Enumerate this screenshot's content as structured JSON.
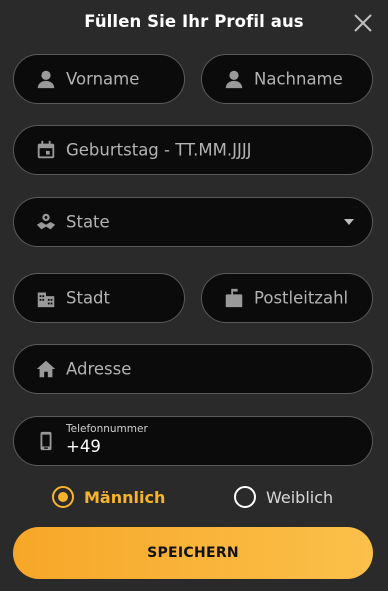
{
  "header": {
    "title": "Füllen Sie Ihr Profil aus"
  },
  "fields": {
    "first_name": {
      "placeholder": "Vorname",
      "icon": "user-icon"
    },
    "last_name": {
      "placeholder": "Nachname",
      "icon": "user-icon"
    },
    "birthday": {
      "placeholder": "Geburtstag - TT.MM.JJJJ",
      "icon": "calendar-icon"
    },
    "state": {
      "placeholder": "State",
      "icon": "map-icon"
    },
    "city": {
      "placeholder": "Stadt",
      "icon": "building-icon"
    },
    "postal": {
      "placeholder": "Postleitzahl",
      "icon": "mailbox-icon"
    },
    "address": {
      "placeholder": "Adresse",
      "icon": "home-icon"
    },
    "phone": {
      "label": "Telefonnummer",
      "value": "+49",
      "icon": "phone-icon"
    }
  },
  "gender": {
    "male": "Männlich",
    "female": "Weiblich",
    "selected": "male"
  },
  "actions": {
    "save_label": "SPEICHERN"
  },
  "colors": {
    "background": "#2a2a2a",
    "field_bg": "#0b0b0b",
    "field_border": "#5a5a5a",
    "accent": "#f7b32a",
    "placeholder": "#b3b3b3"
  }
}
